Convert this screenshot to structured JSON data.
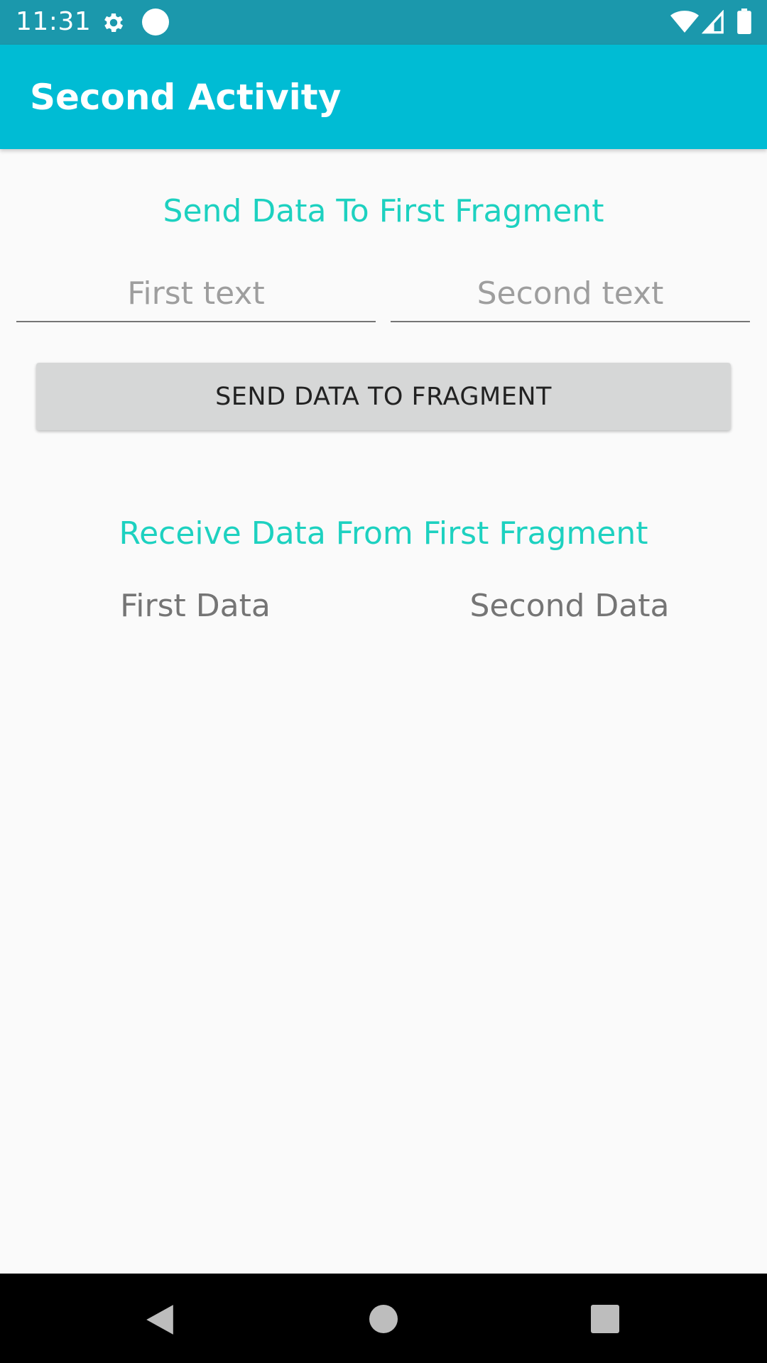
{
  "status_bar": {
    "time": "11:31",
    "icons": [
      "gear-icon",
      "circle-icon",
      "wifi-icon",
      "signal-icon",
      "battery-icon"
    ],
    "background_color": "#1b98ac"
  },
  "app_bar": {
    "title": "Second Activity",
    "background_color": "#00bcd4"
  },
  "send_section": {
    "heading": "Send Data To First Fragment",
    "first_field": {
      "value": "",
      "placeholder": "First text"
    },
    "second_field": {
      "value": "",
      "placeholder": "Second text"
    },
    "button_label": "SEND DATA TO FRAGMENT"
  },
  "receive_section": {
    "heading": "Receive Data From First Fragment",
    "first_data": "First Data",
    "second_data": "Second Data"
  },
  "accent_color": "#1dd1c0",
  "nav_bar": {
    "icons": [
      "back-icon",
      "home-icon",
      "recents-icon"
    ]
  }
}
